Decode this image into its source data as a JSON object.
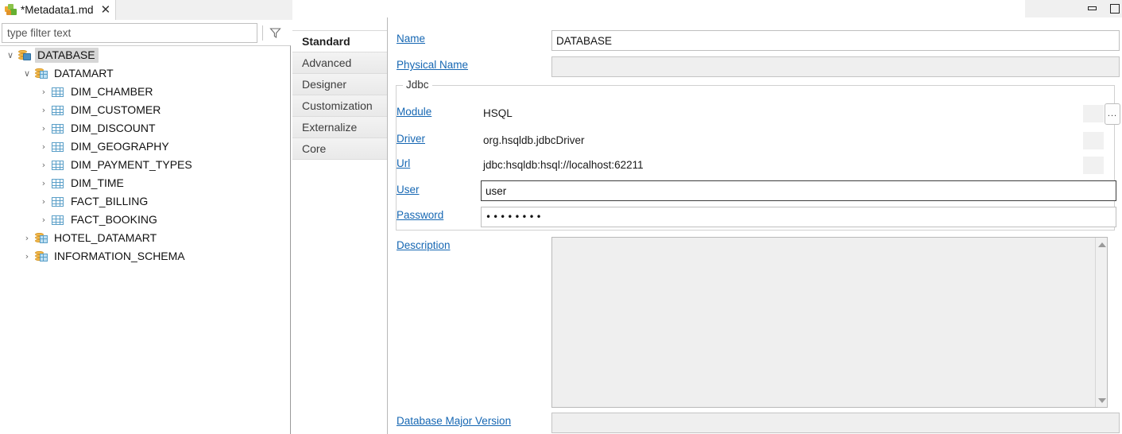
{
  "window": {
    "minimize_icon": "minimize-icon",
    "maximize_icon": "maximize-icon"
  },
  "editor_tab": {
    "icon": "plugin-icon",
    "title": "*Metadata1.md",
    "close_label": "✕"
  },
  "filter": {
    "placeholder": "type filter text",
    "value": "",
    "funnel_icon": "filter-funnel-icon"
  },
  "tree": {
    "items": [
      {
        "label": "DATABASE",
        "depth": 0,
        "twisty": "∨",
        "icon": "database-icon",
        "selected": true
      },
      {
        "label": "DATAMART",
        "depth": 1,
        "twisty": "∨",
        "icon": "schema-icon",
        "selected": false
      },
      {
        "label": "DIM_CHAMBER",
        "depth": 2,
        "twisty": "›",
        "icon": "table-icon",
        "selected": false
      },
      {
        "label": "DIM_CUSTOMER",
        "depth": 2,
        "twisty": "›",
        "icon": "table-icon",
        "selected": false
      },
      {
        "label": "DIM_DISCOUNT",
        "depth": 2,
        "twisty": "›",
        "icon": "table-icon",
        "selected": false
      },
      {
        "label": "DIM_GEOGRAPHY",
        "depth": 2,
        "twisty": "›",
        "icon": "table-icon",
        "selected": false
      },
      {
        "label": "DIM_PAYMENT_TYPES",
        "depth": 2,
        "twisty": "›",
        "icon": "table-icon",
        "selected": false
      },
      {
        "label": "DIM_TIME",
        "depth": 2,
        "twisty": "›",
        "icon": "table-icon",
        "selected": false
      },
      {
        "label": "FACT_BILLING",
        "depth": 2,
        "twisty": "›",
        "icon": "table-icon",
        "selected": false
      },
      {
        "label": "FACT_BOOKING",
        "depth": 2,
        "twisty": "›",
        "icon": "table-icon",
        "selected": false
      },
      {
        "label": "HOTEL_DATAMART",
        "depth": 1,
        "twisty": "›",
        "icon": "schema-icon",
        "selected": false
      },
      {
        "label": "INFORMATION_SCHEMA",
        "depth": 1,
        "twisty": "›",
        "icon": "schema-icon",
        "selected": false
      }
    ]
  },
  "tag_list": {
    "items": [
      {
        "label": "Standard",
        "active": true
      },
      {
        "label": "Advanced",
        "active": false
      },
      {
        "label": "Designer",
        "active": false
      },
      {
        "label": "Customization",
        "active": false
      },
      {
        "label": "Externalize",
        "active": false
      },
      {
        "label": "Core",
        "active": false
      }
    ]
  },
  "form": {
    "name": {
      "label": "Name",
      "value": "DATABASE"
    },
    "physical_name": {
      "label": "Physical Name",
      "value": ""
    },
    "jdbc": {
      "title": "Jdbc",
      "module": {
        "label": "Module",
        "value": "HSQL"
      },
      "driver": {
        "label": "Driver",
        "value": "org.hsqldb.jdbcDriver"
      },
      "url": {
        "label": "Url",
        "value": "jdbc:hsqldb:hsql://localhost:62211"
      },
      "user": {
        "label": "User",
        "value": "user"
      },
      "password": {
        "label": "Password",
        "value": "••••••••"
      },
      "browse_button": "..."
    },
    "description": {
      "label": "Description",
      "value": ""
    },
    "database_major_version": {
      "label": "Database Major Version",
      "value": ""
    }
  },
  "colors": {
    "link": "#1667b3",
    "selection": "#d6d6d6",
    "readonly_field": "#efefef",
    "panel_border": "#b8b8b8"
  }
}
